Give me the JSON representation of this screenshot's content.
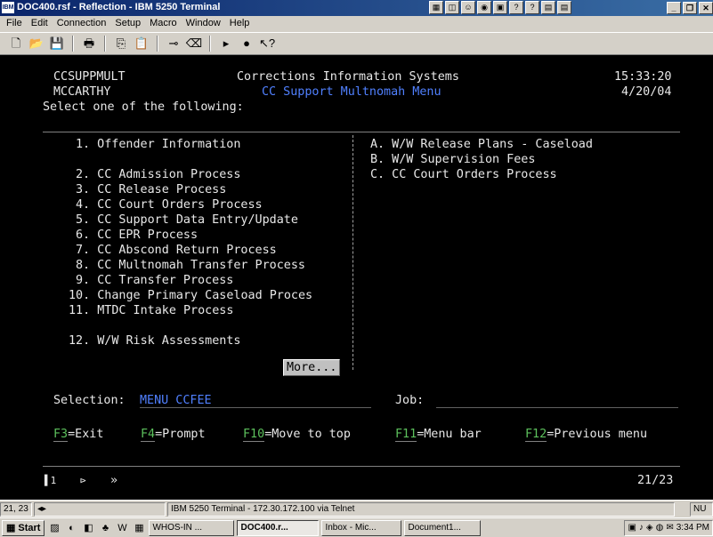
{
  "window": {
    "title": "DOC400.rsf - Reflection - IBM 5250 Terminal",
    "app_icon_text": "IBM"
  },
  "menu": [
    "File",
    "Edit",
    "Connection",
    "Setup",
    "Macro",
    "Window",
    "Help"
  ],
  "terminal": {
    "program_id": "CCSUPPMULT",
    "user": "MCCARTHY",
    "system_title": "Corrections Information Systems",
    "menu_title": "CC Support Multnomah Menu",
    "time": "15:33:20",
    "date": "4/20/04",
    "prompt": "Select one of the following:",
    "left_options": [
      "1. Offender Information",
      "2. CC Admission Process",
      "3. CC Release Process",
      "4. CC Court Orders Process",
      "5. CC Support Data Entry/Update",
      "6. CC EPR Process",
      "7. CC Abscond Return Process",
      "8. CC Multnomah Transfer Process",
      "9. CC Transfer Process",
      "10. Change Primary Caseload Proces",
      "11. MTDC Intake Process",
      "12. W/W Risk Assessments"
    ],
    "right_options": [
      "A. W/W Release Plans - Caseload",
      "B. W/W Supervision Fees",
      "C. CC Court Orders Process"
    ],
    "more_label": "More...",
    "selection_label": "Selection:",
    "selection_value": "MENU CCFEE",
    "job_label": "Job:",
    "fkeys": [
      {
        "key": "F3",
        "label": "=Exit"
      },
      {
        "key": "F4",
        "label": "=Prompt"
      },
      {
        "key": "F10",
        "label": "=Move to top"
      },
      {
        "key": "F11",
        "label": "=Menu bar"
      },
      {
        "key": "F12",
        "label": "=Previous menu"
      }
    ],
    "oia_left": "1",
    "oia_arrow": "»",
    "cursor_pos": "21/23"
  },
  "statusbar": {
    "position": "21, 23",
    "connection": "IBM 5250 Terminal - 172.30.172.100 via Telnet",
    "indicator": "NU"
  },
  "taskbar": {
    "start_label": "Start",
    "tasks": [
      "WHOS-IN ...",
      "DOC400.r...",
      "Inbox - Mic...",
      "Document1..."
    ],
    "clock": "3:34 PM"
  }
}
